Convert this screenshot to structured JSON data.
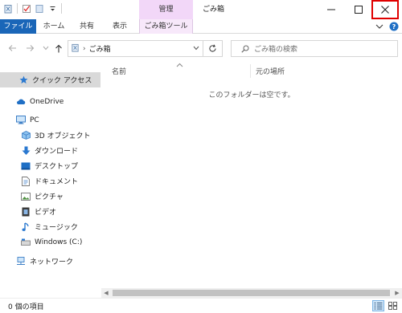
{
  "title_bar": {
    "context_tab_header": "管理",
    "window_title": "ごみ箱"
  },
  "ribbon": {
    "tabs": [
      {
        "label": "ファイル"
      },
      {
        "label": "ホーム"
      },
      {
        "label": "共有"
      },
      {
        "label": "表示"
      },
      {
        "label": "ごみ箱ツール"
      }
    ]
  },
  "address_bar": {
    "path_text": "ごみ箱",
    "separator": "›",
    "search_placeholder": "ごみ箱の検索"
  },
  "navigation_pane": {
    "items": [
      {
        "label": "クイック アクセス",
        "icon": "star-icon"
      },
      {
        "label": "OneDrive",
        "icon": "cloud-icon"
      },
      {
        "label": "PC",
        "icon": "computer-icon"
      },
      {
        "label": "3D オブジェクト",
        "icon": "cube-icon"
      },
      {
        "label": "ダウンロード",
        "icon": "download-arrow-icon"
      },
      {
        "label": "デスクトップ",
        "icon": "desktop-icon"
      },
      {
        "label": "ドキュメント",
        "icon": "document-icon"
      },
      {
        "label": "ピクチャ",
        "icon": "picture-icon"
      },
      {
        "label": "ビデオ",
        "icon": "video-icon"
      },
      {
        "label": "ミュージック",
        "icon": "music-note-icon"
      },
      {
        "label": "Windows (C:)",
        "icon": "drive-icon"
      },
      {
        "label": "ネットワーク",
        "icon": "network-icon"
      }
    ]
  },
  "file_list": {
    "columns": [
      {
        "label": "名前"
      },
      {
        "label": "元の場所"
      }
    ],
    "empty_message": "このフォルダーは空です。"
  },
  "status_bar": {
    "item_count": "0 個の項目"
  },
  "colors": {
    "file_tab": "#1a66b8",
    "context_tab": "#f2d7f8",
    "selection": "#d9d9d9",
    "close_highlight": "#e00000"
  }
}
